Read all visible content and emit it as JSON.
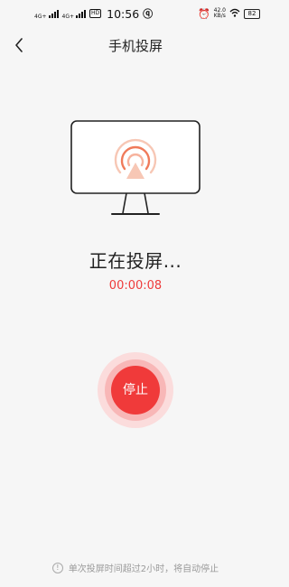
{
  "status_bar": {
    "sim1_network": "4G+",
    "sim2_network": "4G+",
    "hd_badge": "HD",
    "time": "10:56",
    "net_speed_value": "42.0",
    "net_speed_unit": "KB/s",
    "battery": "82"
  },
  "nav": {
    "title": "手机投屏"
  },
  "cast": {
    "status_text": "正在投屏...",
    "elapsed": "00:00:08",
    "stop_label": "停止"
  },
  "footer": {
    "note": "单次投屏时间超过2小时，将自动停止"
  },
  "colors": {
    "accent_red": "#f03a3a",
    "cast_orange": "#f07a5a",
    "background": "#f6f6f6"
  }
}
